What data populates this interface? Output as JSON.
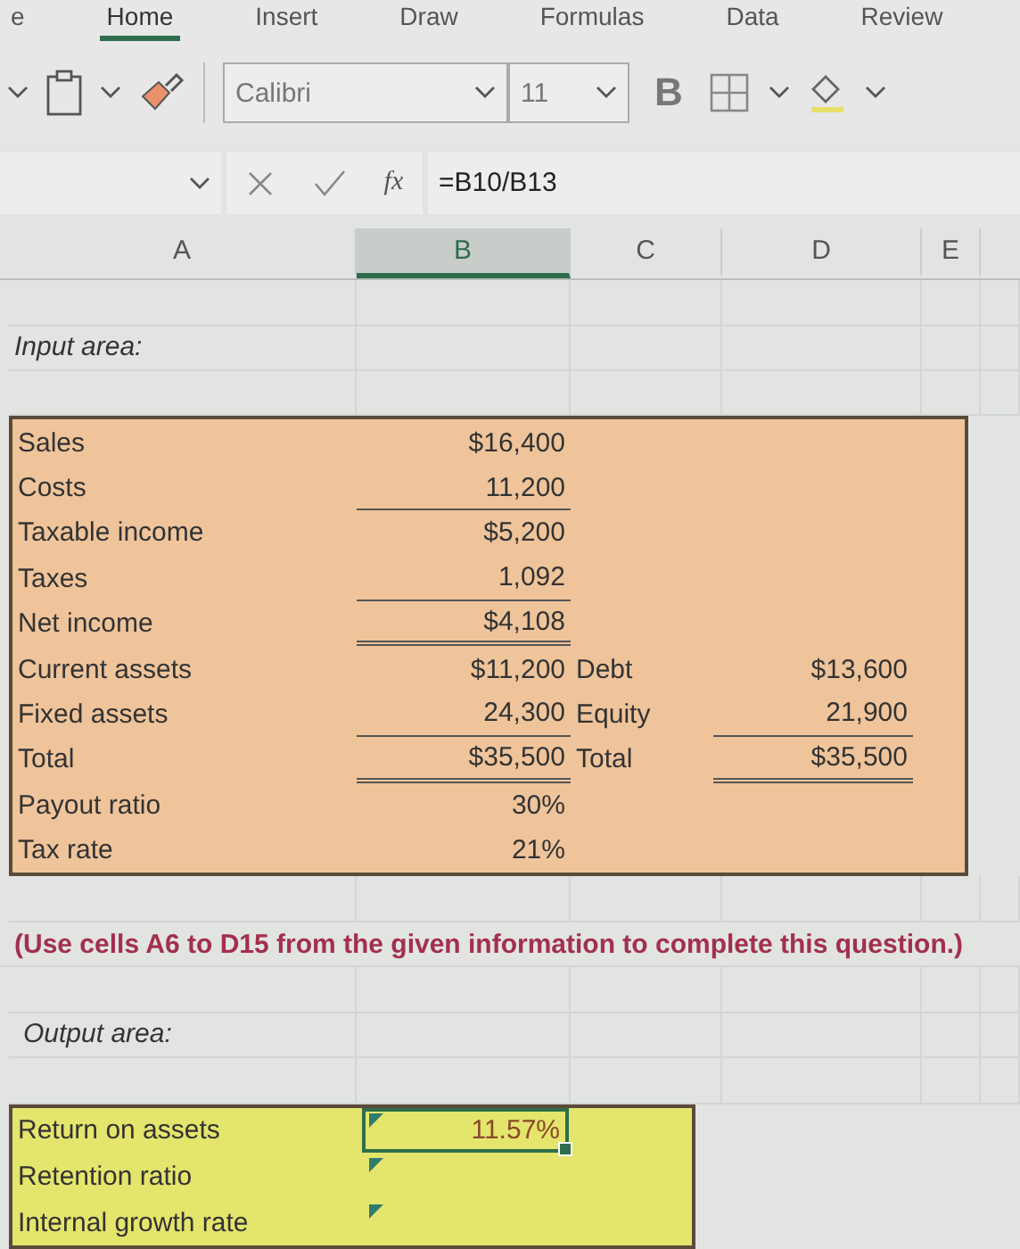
{
  "tabs": [
    {
      "label": "e",
      "selected": false
    },
    {
      "label": "Home",
      "selected": true
    },
    {
      "label": "Insert",
      "selected": false
    },
    {
      "label": "Draw",
      "selected": false
    },
    {
      "label": "Formulas",
      "selected": false
    },
    {
      "label": "Data",
      "selected": false
    },
    {
      "label": "Review",
      "selected": false
    }
  ],
  "ribbon": {
    "font": "Calibri",
    "size": "11",
    "bold": "B"
  },
  "formula_bar": {
    "fx": "fx",
    "formula": "=B10/B13"
  },
  "columns": [
    {
      "label": "A",
      "selected": false
    },
    {
      "label": "B",
      "selected": true
    },
    {
      "label": "C",
      "selected": false
    },
    {
      "label": "D",
      "selected": false
    },
    {
      "label": "E",
      "selected": false
    }
  ],
  "input_label": "Input area:",
  "input_rows": [
    {
      "label": "Sales",
      "value": "$16,400"
    },
    {
      "label": "Costs",
      "value": "11,200",
      "underlined": true
    },
    {
      "label": "Taxable income",
      "value": "$5,200"
    },
    {
      "label": "Taxes",
      "value": "1,092",
      "underlined": true
    },
    {
      "label": "Net income",
      "value": "$4,108",
      "double_underlined": true
    },
    {
      "label": "Current assets",
      "value": "$11,200",
      "c": "Debt",
      "d": "$13,600"
    },
    {
      "label": "Fixed assets",
      "value": "24,300",
      "underlined": true,
      "c": "Equity",
      "d": "21,900",
      "d_underlined": true
    },
    {
      "label": "Total",
      "value": "$35,500",
      "double_underlined": true,
      "c": "Total",
      "d": "$35,500",
      "d_double_underlined": true
    },
    {
      "label": "Payout ratio",
      "value": "30%"
    },
    {
      "label": "Tax rate",
      "value": "21%"
    }
  ],
  "note": "(Use cells A6 to D15 from the given information to complete this question.)",
  "output_label": "Output area:",
  "output_rows": [
    {
      "label": "Return on assets",
      "value": "11.57%",
      "selected": true
    },
    {
      "label": "Retention ratio",
      "selected": false
    },
    {
      "label": "Internal growth rate",
      "selected": false
    }
  ]
}
